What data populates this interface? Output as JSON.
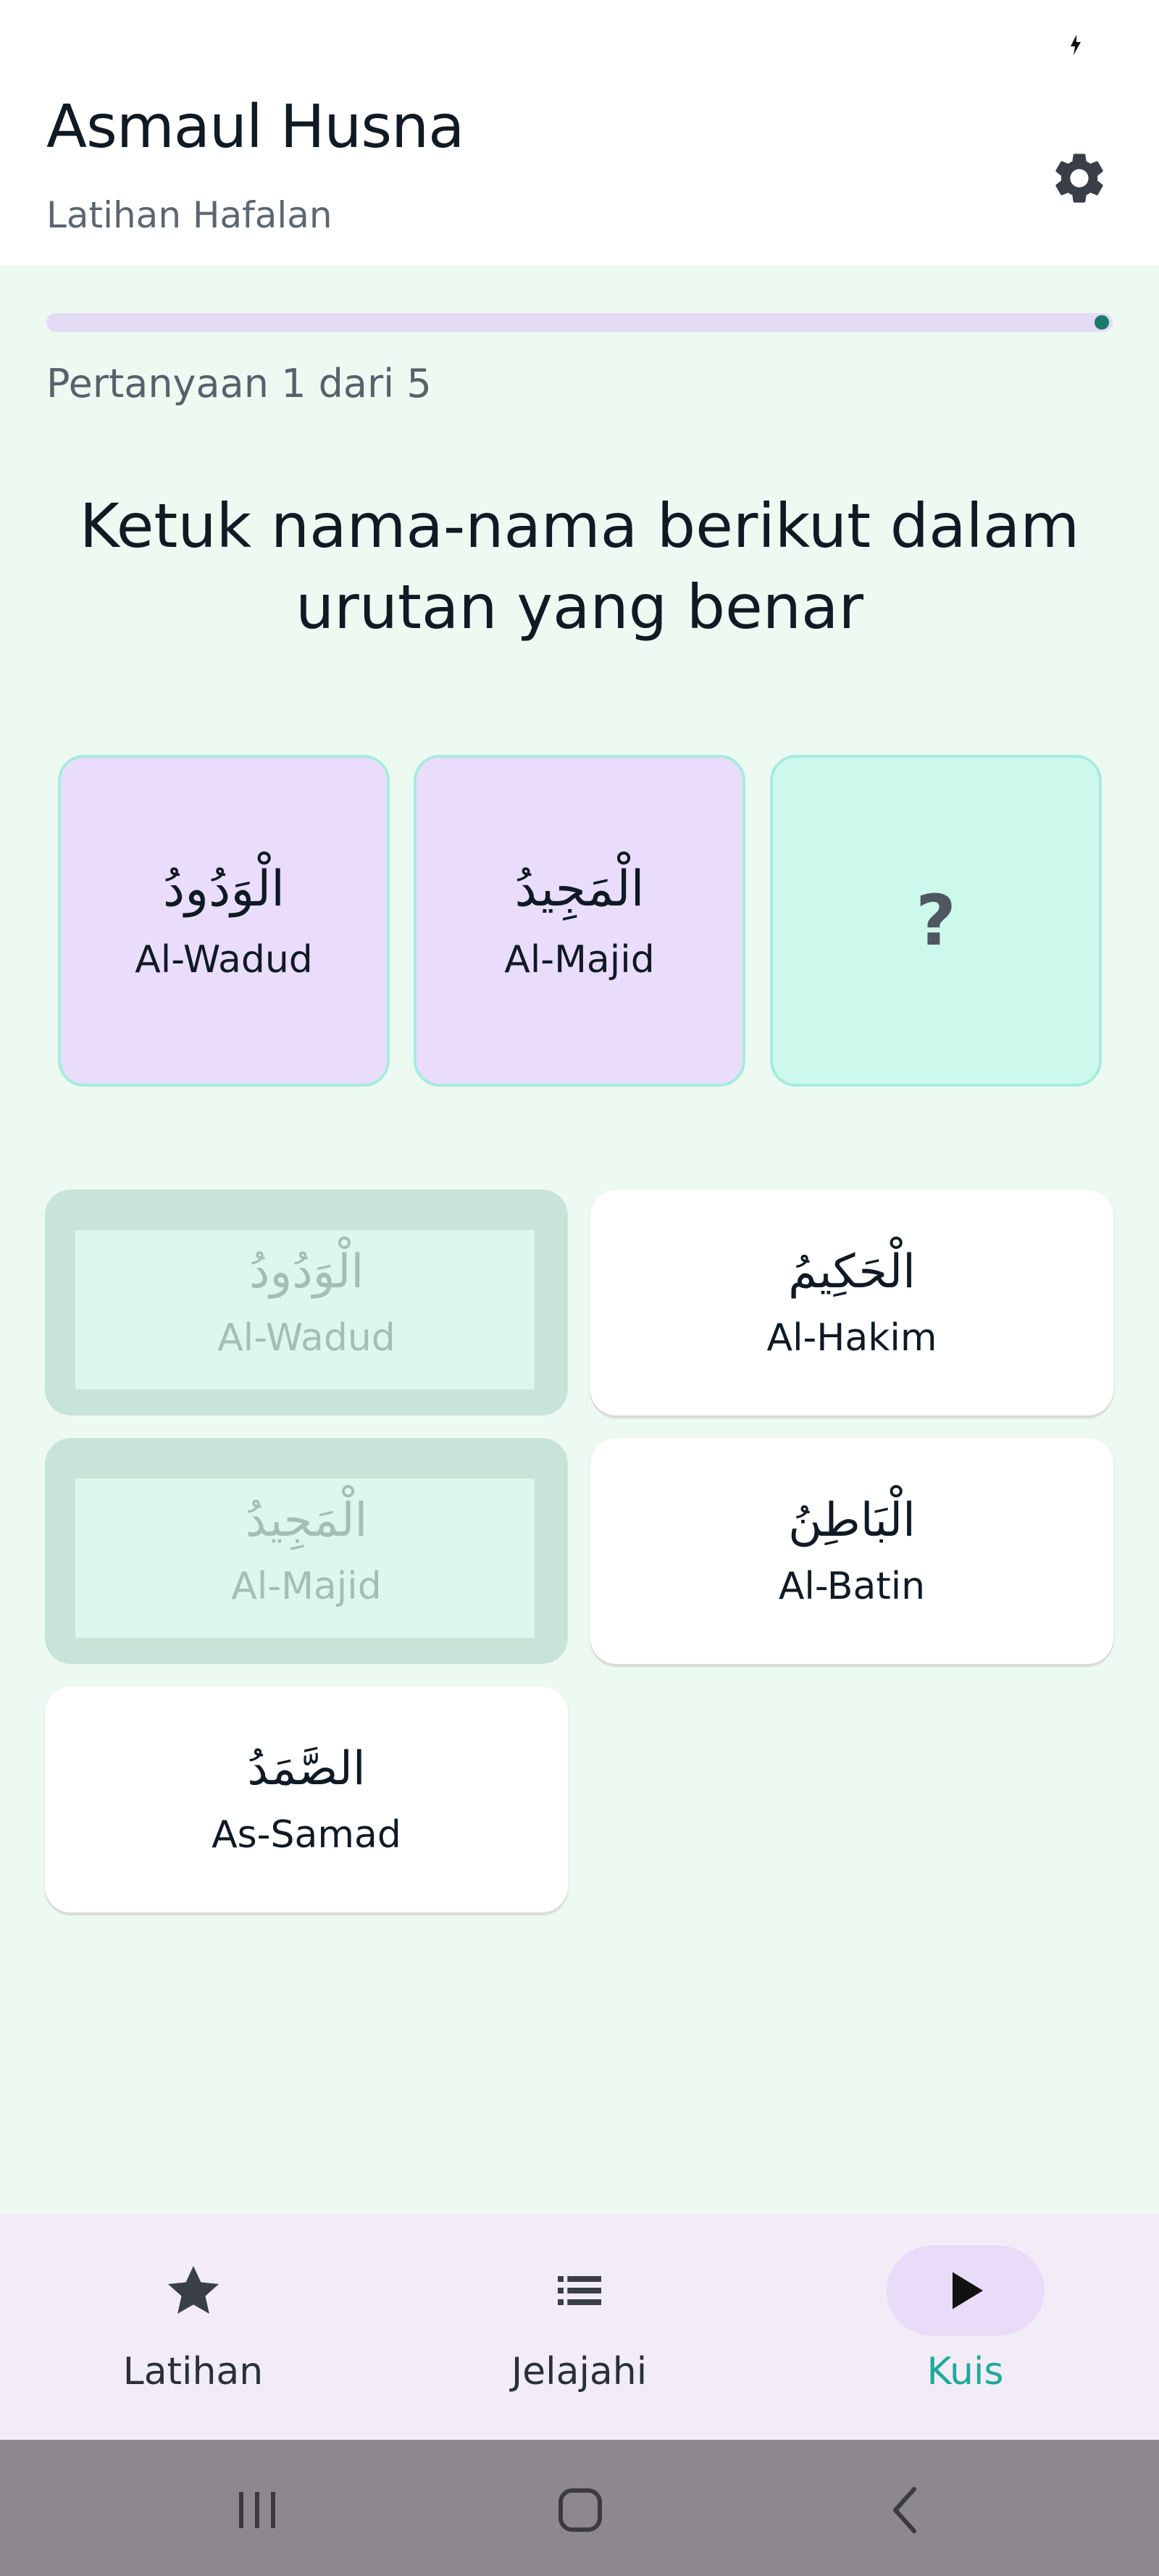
{
  "header": {
    "title": "Asmaul Husna",
    "subtitle": "Latihan Hafalan"
  },
  "quiz": {
    "progress_fraction": 0.2,
    "question_count": "Pertanyaan 1 dari 5",
    "instruction": "Ketuk nama-nama berikut dalam urutan yang benar",
    "slots": [
      {
        "arabic": "الْوَدُودُ",
        "latin": "Al-Wadud",
        "state": "filled"
      },
      {
        "arabic": "الْمَجِيدُ",
        "latin": "Al-Majid",
        "state": "filled"
      },
      {
        "placeholder": "?",
        "state": "empty"
      }
    ],
    "options": [
      {
        "arabic": "الْوَدُودُ",
        "latin": "Al-Wadud",
        "state": "used"
      },
      {
        "arabic": "الْحَكِيمُ",
        "latin": "Al-Hakim",
        "state": "active"
      },
      {
        "arabic": "الْمَجِيدُ",
        "latin": "Al-Majid",
        "state": "used"
      },
      {
        "arabic": "الْبَاطِنُ",
        "latin": "Al-Batin",
        "state": "active"
      },
      {
        "arabic": "الصَّمَدُ",
        "latin": "As-Samad",
        "state": "active"
      }
    ]
  },
  "bottom_nav": {
    "items": [
      {
        "label": "Latihan",
        "icon": "star-icon",
        "selected": false
      },
      {
        "label": "Jelajahi",
        "icon": "list-icon",
        "selected": false
      },
      {
        "label": "Kuis",
        "icon": "play-icon",
        "selected": true
      }
    ]
  },
  "colors": {
    "background": "#edfaf2",
    "accent": "#1ea99a",
    "slot_filled": "#e9ddfb",
    "slot_empty": "#cdf9ec",
    "nav_background": "#f2ecf7"
  },
  "system_nav": {
    "icons": [
      "recent-apps-icon",
      "home-icon",
      "back-icon"
    ]
  }
}
